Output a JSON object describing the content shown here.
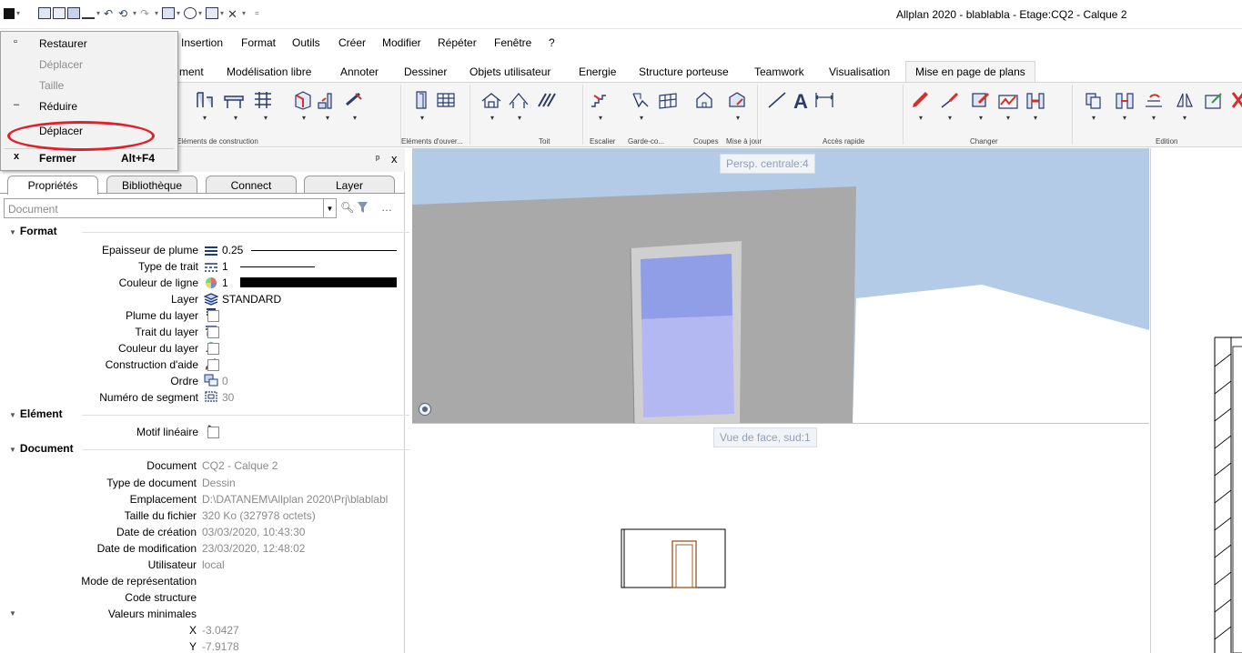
{
  "app": {
    "title": "Allplan 2020 - blablabla - Etage:CQ2 - Calque 2"
  },
  "menubar": {
    "items": [
      "Insertion",
      "Format",
      "Outils",
      "Créer",
      "Modifier",
      "Répéter",
      "Fenêtre",
      "?"
    ]
  },
  "ribbon": {
    "tabs": [
      "ment",
      "Modélisation libre",
      "Annoter",
      "Dessiner",
      "Objets utilisateur",
      "Energie",
      "Structure porteuse",
      "Teamwork",
      "Visualisation",
      "Mise en page de plans"
    ],
    "active_tab": "Mise en page de plans",
    "groups": [
      "Eléments de construction",
      "Eléments d'ouver...",
      "Toit",
      "Escalier",
      "Garde-co...",
      "Coupes",
      "Mise à jour",
      "Accès rapide",
      "Changer",
      "Edition"
    ]
  },
  "system_menu": {
    "items": [
      {
        "label": "Restaurer",
        "mark": "▫",
        "disabled": false
      },
      {
        "label": "Déplacer",
        "mark": "",
        "disabled": true
      },
      {
        "label": "Taille",
        "mark": "",
        "disabled": true
      },
      {
        "label": "Réduire",
        "mark": "–",
        "disabled": false
      },
      {
        "label": "Déplacer",
        "mark": "",
        "disabled": false
      },
      {
        "label": "Fermer",
        "mark": "x",
        "disabled": false,
        "shortcut": "Alt+F4"
      }
    ]
  },
  "panel": {
    "tabs": [
      "Propriétés",
      "Bibliothèque",
      "Connect",
      "Layer"
    ],
    "active_tab": "Propriétés",
    "document_selector": "Document",
    "pin": "ᵖ",
    "close": "x",
    "sections": {
      "format": "Format",
      "element": "Elément",
      "document": "Document"
    },
    "format_props": [
      {
        "label": "Epaisseur de plume",
        "value": "0.25"
      },
      {
        "label": "Type de trait",
        "value": "1"
      },
      {
        "label": "Couleur de ligne",
        "value": "1"
      },
      {
        "label": "Layer",
        "value": "STANDARD"
      },
      {
        "label": "Plume du layer",
        "value": ""
      },
      {
        "label": "Trait du layer",
        "value": ""
      },
      {
        "label": "Couleur du layer",
        "value": ""
      },
      {
        "label": "Construction d'aide",
        "value": ""
      },
      {
        "label": "Ordre",
        "value": "0"
      },
      {
        "label": "Numéro de segment",
        "value": "30"
      }
    ],
    "element_props": [
      {
        "label": "Motif linéaire",
        "value": ""
      }
    ],
    "document_props": [
      {
        "label": "Document",
        "value": "CQ2 - Calque 2"
      },
      {
        "label": "Type de document",
        "value": "Dessin"
      },
      {
        "label": "Emplacement",
        "value": "D:\\DATANEM\\Allplan 2020\\Prj\\blablabl"
      },
      {
        "label": "Taille du fichier",
        "value": "320 Ko (327978 octets)"
      },
      {
        "label": "Date de création",
        "value": "03/03/2020, 10:43:30"
      },
      {
        "label": "Date de modification",
        "value": "23/03/2020, 12:48:02"
      },
      {
        "label": "Utilisateur",
        "value": "local"
      },
      {
        "label": "Mode de représentation",
        "value": ""
      },
      {
        "label": "Code structure",
        "value": ""
      },
      {
        "label": "Valeurs minimales",
        "value": ""
      },
      {
        "label": "X",
        "value": "-3.0427"
      },
      {
        "label": "Y",
        "value": "-7.9178"
      }
    ]
  },
  "viewports": {
    "top_label": "Persp. centrale:4",
    "bottom_label": "Vue de face, sud:1"
  },
  "colors": {
    "sky": "#b3cbe6",
    "wall": "#a9a9a9",
    "glass_top": "#8f9ee6",
    "glass_bottom": "#b4b8f2",
    "highlight": "#e0202a",
    "door_line": "#a0602a"
  }
}
